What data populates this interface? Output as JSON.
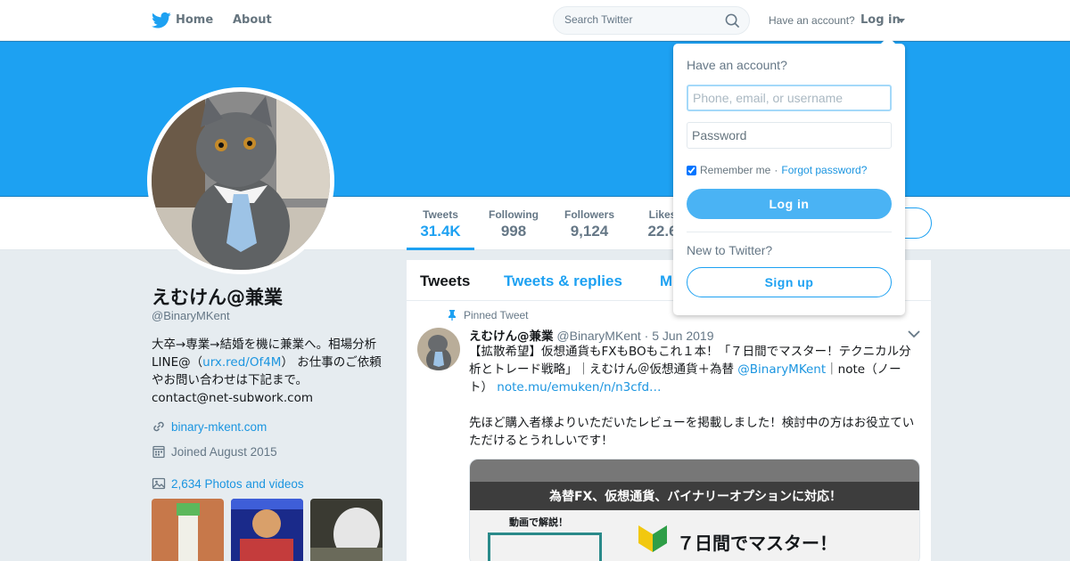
{
  "nav": {
    "home_label": "Home",
    "about_label": "About",
    "search_placeholder": "Search Twitter",
    "have_account_text": "Have an account?",
    "login_label": "Log in"
  },
  "profile": {
    "name": "えむけん@兼業",
    "handle": "@BinaryMKent",
    "bio_part1": "大卒→専業→結婚を機に兼業へ。相場分析LINE@（",
    "bio_link": "urx.red/Of4M",
    "bio_part2": "） お仕事のご依頼やお問い合わせは下記まで。",
    "bio_email": "contact@net-subwork.com",
    "website": "binary-mkent.com",
    "joined": "Joined August 2015",
    "photos_videos": "2,634 Photos and videos"
  },
  "stats": [
    {
      "label": "Tweets",
      "value": "31.4K"
    },
    {
      "label": "Following",
      "value": "998"
    },
    {
      "label": "Followers",
      "value": "9,124"
    },
    {
      "label": "Likes",
      "value": "22.6"
    }
  ],
  "tabs": [
    "Tweets",
    "Tweets & replies",
    "M"
  ],
  "tweet": {
    "pinned_label": "Pinned Tweet",
    "name": "えむけん@兼業",
    "handle": "@BinaryMKent",
    "date": "· 5 Jun 2019",
    "text1": "【拡散希望】仮想通貨もFXもBOもこれ１本！「７日間でマスター！テクニカル分析とトレード戦略」｜えむけん＠仮想通貨＋為替 ",
    "mention": "@BinaryMKent",
    "text2": "｜note（ノート） ",
    "link": "note.mu/emuken/n/n3cfd…",
    "text3": "先ほど購入者様よりいただいたレビューを掲載しました！検討中の方はお役立ていただけるとうれしいです！",
    "media_band": "為替FX、仮想通貨、バイナリーオプションに対応！",
    "media_label": "動画で解説！",
    "media_big": "７日間でマスター！"
  },
  "login_dropdown": {
    "title": "Have an account?",
    "username_placeholder": "Phone, email, or username",
    "password_placeholder": "Password",
    "remember_label": "Remember me",
    "forgot_label": "Forgot password?",
    "login_button": "Log in",
    "new_text": "New to Twitter?",
    "signup_button": "Sign up"
  },
  "colors": {
    "brand": "#1da1f2",
    "banner": "#1da1f2",
    "text": "#14171a",
    "muted": "#657786"
  }
}
